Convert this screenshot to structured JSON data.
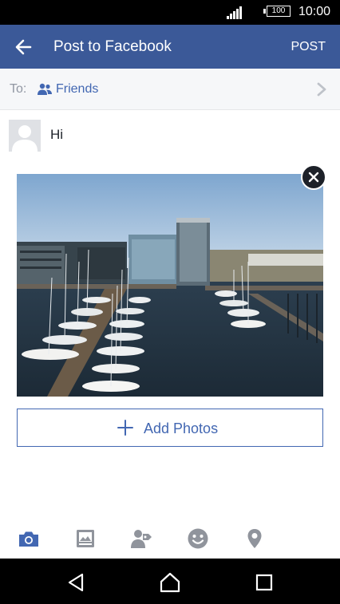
{
  "status_bar": {
    "battery": "100",
    "time": "10:00"
  },
  "app_bar": {
    "title": "Post to Facebook",
    "post_label": "POST"
  },
  "audience": {
    "to_label": "To:",
    "value": "Friends"
  },
  "composer": {
    "text": "Hi"
  },
  "actions": {
    "add_photos_label": "Add Photos"
  },
  "toolbar": {
    "icons": [
      "camera-icon",
      "photo-album-icon",
      "tag-people-icon",
      "feeling-icon",
      "location-pin-icon"
    ]
  },
  "navigation": {
    "icons": [
      "back-icon",
      "home-icon",
      "recents-icon"
    ]
  },
  "colors": {
    "brand": "#3b5998",
    "link": "#4267b2",
    "icon_gray": "#90949c"
  }
}
